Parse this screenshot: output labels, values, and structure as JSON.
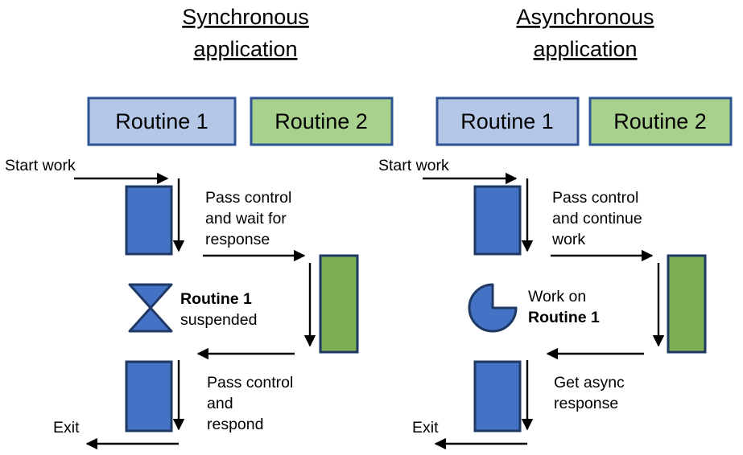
{
  "panels": [
    {
      "id": "synchronous",
      "title_line1": "Synchronous",
      "title_line2": "application",
      "chips": [
        {
          "label": "Routine 1",
          "color": "#B4C7E7"
        },
        {
          "label": "Routine 2",
          "color": "#A9D18E"
        }
      ],
      "entry_label": "Start work",
      "exit_label": "Exit",
      "edge_labels": [
        {
          "lines": [
            "Pass control",
            "and wait for",
            "response"
          ]
        },
        {
          "lines": [
            "Pass control",
            "and",
            "respond"
          ]
        }
      ],
      "state_icon": "hourglass-icon",
      "state_text": {
        "bold_line": "Routine 1",
        "plain_line": "suspended"
      }
    },
    {
      "id": "asynchronous",
      "title_line1": "Asynchronous",
      "title_line2": "application",
      "chips": [
        {
          "label": "Routine 1",
          "color": "#B4C7E7"
        },
        {
          "label": "Routine 2",
          "color": "#A9D18E"
        }
      ],
      "entry_label": "Start work",
      "exit_label": "Exit",
      "edge_labels": [
        {
          "lines": [
            "Pass control",
            "and continue",
            "work"
          ]
        },
        {
          "lines": [
            "Get async",
            "response"
          ]
        }
      ],
      "state_icon": "pie-progress-icon",
      "state_text": {
        "plain_line": "Work on",
        "bold_line": "Routine 1"
      }
    }
  ],
  "colors": {
    "bar_blue": "#4472C4",
    "bar_green": "#7CAF53",
    "chip_blue": "#B4C7E7",
    "chip_green": "#A9D18E",
    "border_navy": "#1F3864",
    "chip_border": "#2E5496",
    "arrow_black": "#000000",
    "background": "#FFFFFF"
  }
}
